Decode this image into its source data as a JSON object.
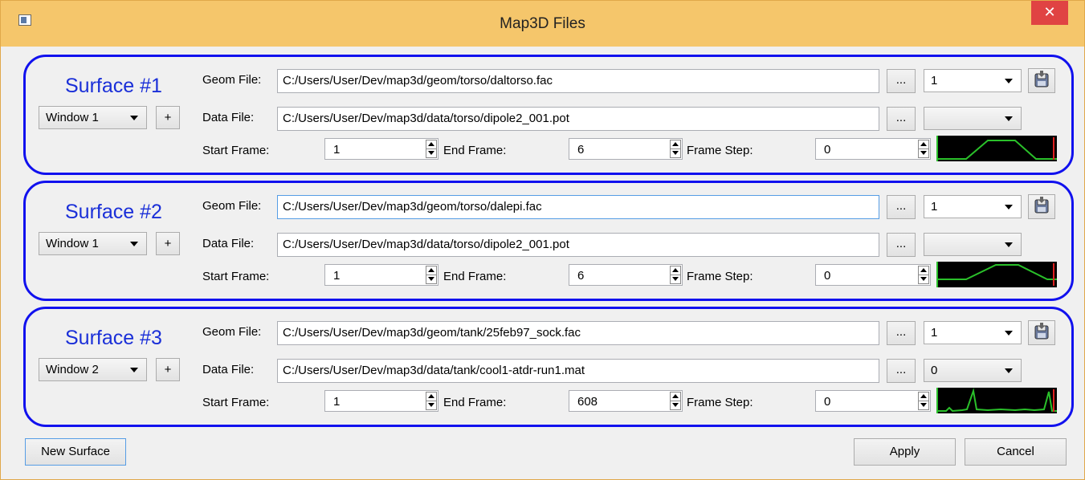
{
  "window": {
    "title": "Map3D Files",
    "close_glyph": "✕"
  },
  "surfaces": [
    {
      "title": "Surface #1",
      "window_select": "Window 1",
      "plus_label": "+",
      "geom_label": "Geom File:",
      "geom_file": "C:/Users/User/Dev/map3d/geom/torso/daltorso.fac",
      "geom_index": "1",
      "data_label": "Data File:",
      "data_file": "C:/Users/User/Dev/map3d/data/torso/dipole2_001.pot",
      "data_index": "",
      "browse_label": "...",
      "start_label": "Start Frame:",
      "start_frame": "1",
      "end_label": "End Frame:",
      "end_frame": "6",
      "step_label": "Frame Step:",
      "frame_step": "0",
      "graph": "trapezoid"
    },
    {
      "title": "Surface #2",
      "window_select": "Window 1",
      "plus_label": "+",
      "geom_label": "Geom File:",
      "geom_file": "C:/Users/User/Dev/map3d/geom/torso/dalepi.fac",
      "geom_index": "1",
      "data_label": "Data File:",
      "data_file": "C:/Users/User/Dev/map3d/data/torso/dipole2_001.pot",
      "data_index": "",
      "browse_label": "...",
      "start_label": "Start Frame:",
      "start_frame": "1",
      "end_label": "End Frame:",
      "end_frame": "6",
      "step_label": "Frame Step:",
      "frame_step": "0",
      "graph": "trapezoid"
    },
    {
      "title": "Surface #3",
      "window_select": "Window 2",
      "plus_label": "+",
      "geom_label": "Geom File:",
      "geom_file": "C:/Users/User/Dev/map3d/geom/tank/25feb97_sock.fac",
      "geom_index": "1",
      "data_label": "Data File:",
      "data_file": "C:/Users/User/Dev/map3d/data/tank/cool1-atdr-run1.mat",
      "data_index": "0",
      "browse_label": "...",
      "start_label": "Start Frame:",
      "start_frame": "1",
      "end_label": "End Frame:",
      "end_frame": "608",
      "step_label": "Frame Step:",
      "frame_step": "0",
      "graph": "ecg"
    }
  ],
  "footer": {
    "new_surface": "New Surface",
    "apply": "Apply",
    "cancel": "Cancel"
  },
  "colors": {
    "titlebar": "#f5c66b",
    "group_border": "#1111ee",
    "surface_title": "#1a2fd8",
    "close": "#e04343",
    "graph_line": "#2ac02a",
    "graph_marker": "#e02020"
  },
  "icons": {
    "save": "save-disk-icon",
    "app": "app-window-icon",
    "close": "close-icon"
  }
}
